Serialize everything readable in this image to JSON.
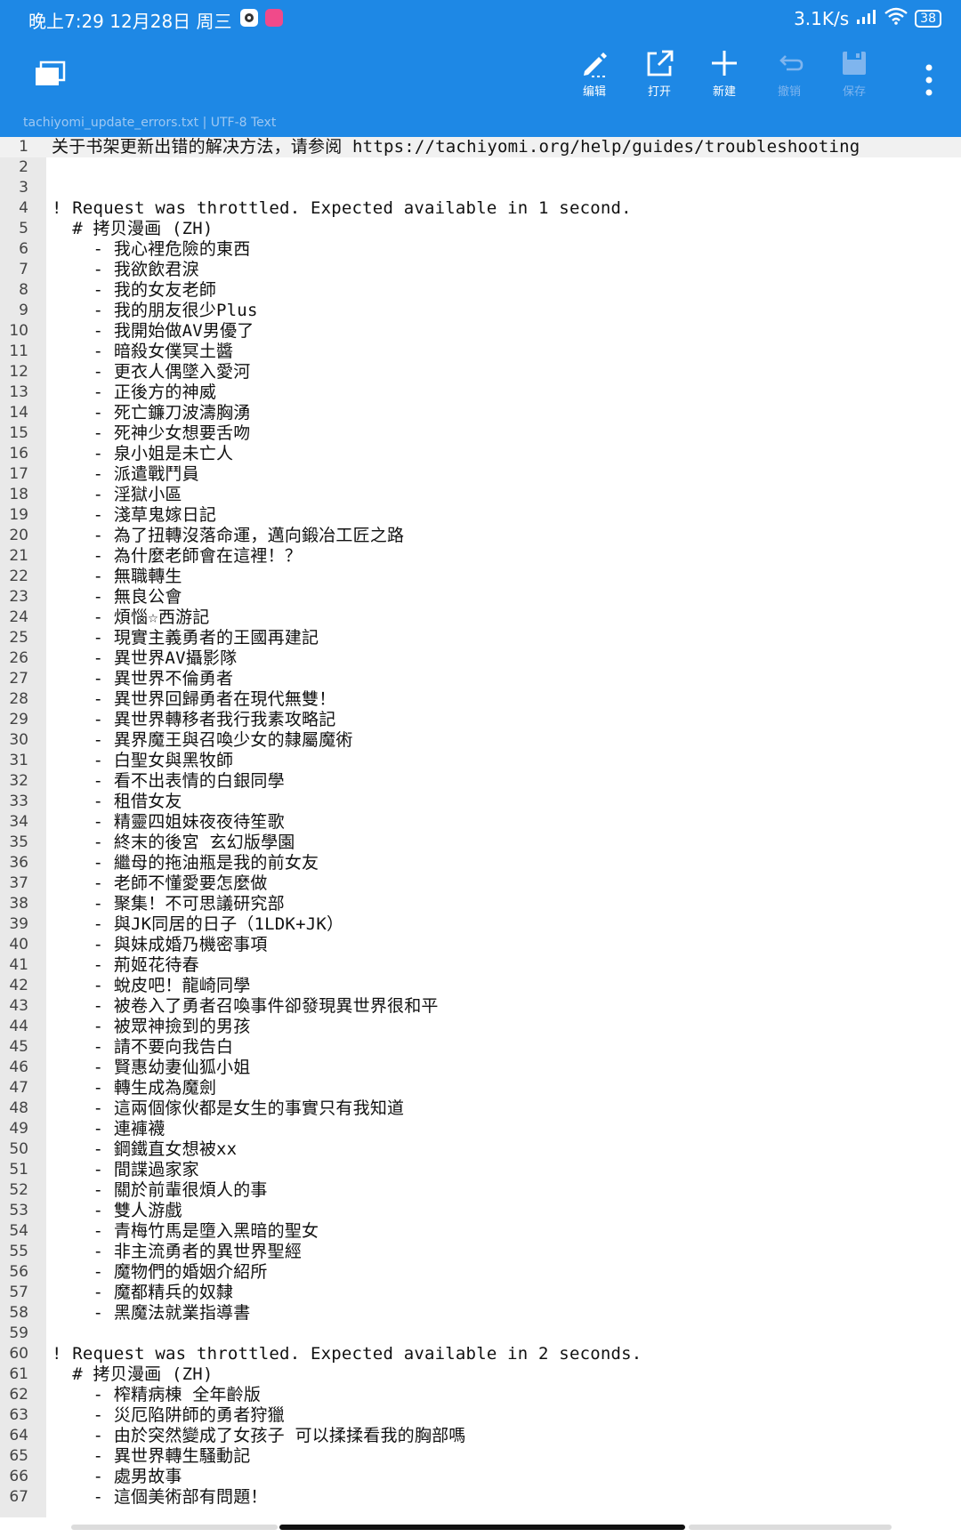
{
  "status_bar": {
    "time": "晚上7:29 12月28日 周三",
    "net_speed": "3.1K/s",
    "battery": "38"
  },
  "toolbar": {
    "buttons": [
      {
        "label": "编辑",
        "icon": "pencil-icon"
      },
      {
        "label": "打开",
        "icon": "open-external-icon"
      },
      {
        "label": "新建",
        "icon": "plus-icon"
      },
      {
        "label": "撤销",
        "icon": "undo-icon"
      },
      {
        "label": "保存",
        "icon": "save-icon"
      }
    ],
    "more_icon": "more-vertical-icon",
    "tabs_icon": "tabs-icon"
  },
  "file_info": {
    "text": "tachiyomi_update_errors.txt  |  UTF-8  Text"
  },
  "editor": {
    "lines": [
      {
        "n": "1",
        "text": "关于书架更新出错的解决方法，请参阅 https://tachiyomi.org/help/guides/troubleshooting"
      },
      {
        "n": "2",
        "text": ""
      },
      {
        "n": "3",
        "text": ""
      },
      {
        "n": "4",
        "text": "! Request was throttled. Expected available in 1 second."
      },
      {
        "n": "5",
        "text": "  # 拷贝漫画 (ZH)"
      },
      {
        "n": "6",
        "text": "    - 我心裡危險的東西"
      },
      {
        "n": "7",
        "text": "    - 我欲飲君淚"
      },
      {
        "n": "8",
        "text": "    - 我的女友老師"
      },
      {
        "n": "9",
        "text": "    - 我的朋友很少Plus"
      },
      {
        "n": "10",
        "text": "    - 我開始做AV男優了"
      },
      {
        "n": "11",
        "text": "    - 暗殺女僕冥土醬"
      },
      {
        "n": "12",
        "text": "    - 更衣人偶墜入愛河"
      },
      {
        "n": "13",
        "text": "    - 正後方的神威"
      },
      {
        "n": "14",
        "text": "    - 死亡鐮刀波濤胸湧"
      },
      {
        "n": "15",
        "text": "    - 死神少女想要舌吻"
      },
      {
        "n": "16",
        "text": "    - 泉小姐是未亡人"
      },
      {
        "n": "17",
        "text": "    - 派遣戰鬥員"
      },
      {
        "n": "18",
        "text": "    - 淫獄小區"
      },
      {
        "n": "19",
        "text": "    - 淺草鬼嫁日記"
      },
      {
        "n": "20",
        "text": "    - 為了扭轉沒落命運，邁向鍛冶工匠之路"
      },
      {
        "n": "21",
        "text": "    - 為什麼老師會在這裡！？"
      },
      {
        "n": "22",
        "text": "    - 無職轉生"
      },
      {
        "n": "23",
        "text": "    - 無良公會"
      },
      {
        "n": "24",
        "text": "    - 煩惱☆西游記"
      },
      {
        "n": "25",
        "text": "    - 現實主義勇者的王國再建記"
      },
      {
        "n": "26",
        "text": "    - 異世界AV攝影隊"
      },
      {
        "n": "27",
        "text": "    - 異世界不倫勇者"
      },
      {
        "n": "28",
        "text": "    - 異世界回歸勇者在現代無雙！"
      },
      {
        "n": "29",
        "text": "    - 異世界轉移者我行我素攻略記"
      },
      {
        "n": "30",
        "text": "    - 異界魔王與召喚少女的隸屬魔術"
      },
      {
        "n": "31",
        "text": "    - 白聖女與黑牧師"
      },
      {
        "n": "32",
        "text": "    - 看不出表情的白銀同學"
      },
      {
        "n": "33",
        "text": "    - 租借女友"
      },
      {
        "n": "34",
        "text": "    - 精靈四姐妹夜夜待笙歌"
      },
      {
        "n": "35",
        "text": "    - 終末的後宮 玄幻版學園"
      },
      {
        "n": "36",
        "text": "    - 繼母的拖油瓶是我的前女友"
      },
      {
        "n": "37",
        "text": "    - 老師不懂愛要怎麼做"
      },
      {
        "n": "38",
        "text": "    - 聚集！不可思議研究部"
      },
      {
        "n": "39",
        "text": "    - 與JK同居的日子（1LDK+JK）"
      },
      {
        "n": "40",
        "text": "    - 與妹成婚乃機密事項"
      },
      {
        "n": "41",
        "text": "    - 荊姬花待春"
      },
      {
        "n": "42",
        "text": "    - 蛻皮吧！龍崎同學"
      },
      {
        "n": "43",
        "text": "    - 被卷入了勇者召喚事件卻發現異世界很和平"
      },
      {
        "n": "44",
        "text": "    - 被眾神撿到的男孩"
      },
      {
        "n": "45",
        "text": "    - 請不要向我告白"
      },
      {
        "n": "46",
        "text": "    - 賢惠幼妻仙狐小姐"
      },
      {
        "n": "47",
        "text": "    - 轉生成為魔劍"
      },
      {
        "n": "48",
        "text": "    - 這兩個傢伙都是女生的事實只有我知道"
      },
      {
        "n": "49",
        "text": "    - 連褲襪"
      },
      {
        "n": "50",
        "text": "    - 鋼鐵直女想被xx"
      },
      {
        "n": "51",
        "text": "    - 間諜過家家"
      },
      {
        "n": "52",
        "text": "    - 關於前輩很煩人的事"
      },
      {
        "n": "53",
        "text": "    - 雙人游戲"
      },
      {
        "n": "54",
        "text": "    - 青梅竹馬是墮入黑暗的聖女"
      },
      {
        "n": "55",
        "text": "    - 非主流勇者的異世界聖經"
      },
      {
        "n": "56",
        "text": "    - 魔物們的婚姻介紹所"
      },
      {
        "n": "57",
        "text": "    - 魔都精兵的奴隸"
      },
      {
        "n": "58",
        "text": "    - 黑魔法就業指導書"
      },
      {
        "n": "59",
        "text": ""
      },
      {
        "n": "60",
        "text": "! Request was throttled. Expected available in 2 seconds."
      },
      {
        "n": "61",
        "text": "  # 拷贝漫画 (ZH)"
      },
      {
        "n": "62",
        "text": "    - 榨精病棟 全年齡版"
      },
      {
        "n": "63",
        "text": "    - 災厄陷阱師的勇者狩獵"
      },
      {
        "n": "64",
        "text": "    - 由於突然變成了女孩子 可以揉揉看我的胸部嗎"
      },
      {
        "n": "65",
        "text": "    - 異世界轉生騷動記"
      },
      {
        "n": "66",
        "text": "    - 處男故事"
      },
      {
        "n": "67",
        "text": "    - 這個美術部有問題！"
      }
    ]
  }
}
